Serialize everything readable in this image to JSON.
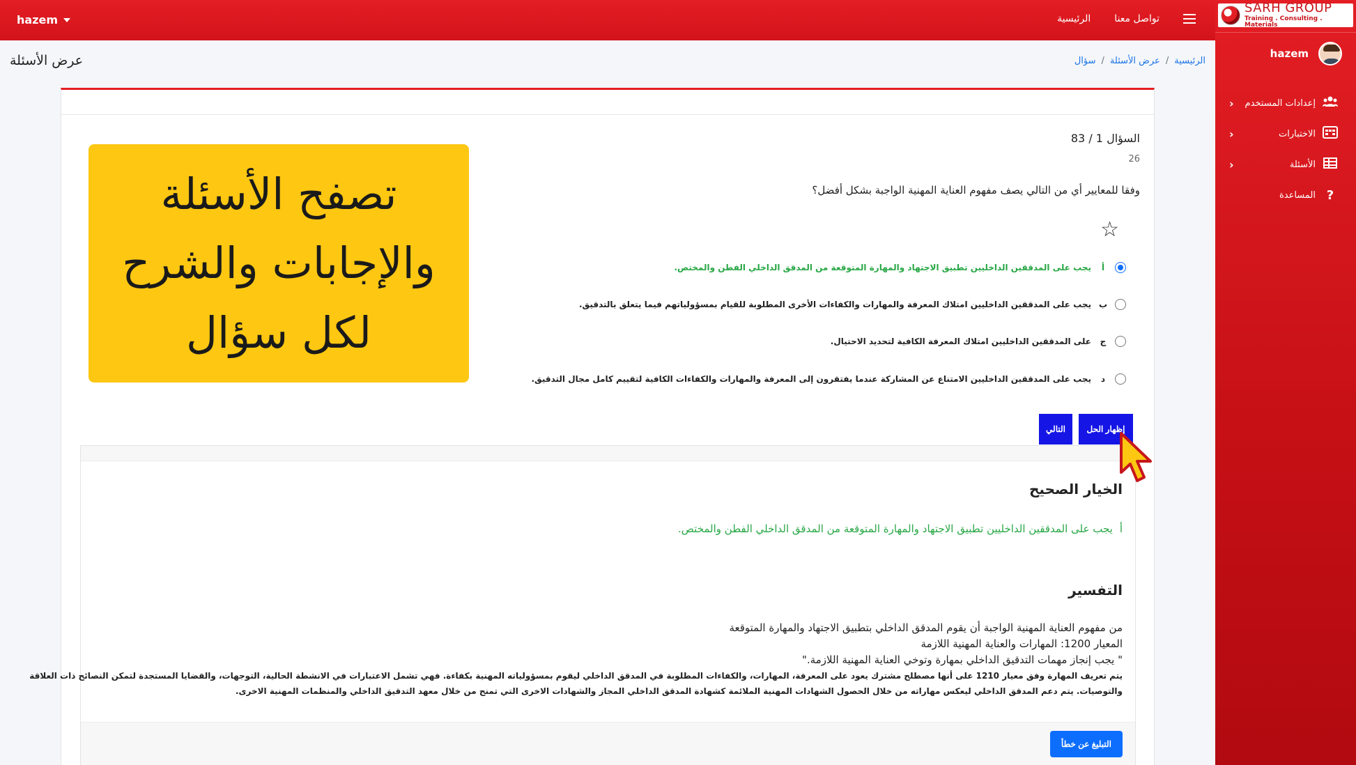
{
  "navbar": {
    "user": "hazem",
    "links": [
      "الرئيسية",
      "تواصل معنا"
    ]
  },
  "sidebar": {
    "logo": {
      "title": "SARH GROUP",
      "subtitle": "Training . Consulting . Materials"
    },
    "user": "hazem",
    "items": [
      {
        "label": "إعدادات المستخدم",
        "icon": "users-icon",
        "has_chevron": true
      },
      {
        "label": "الاختبارات",
        "icon": "tests-icon",
        "has_chevron": true
      },
      {
        "label": "الأسئلة",
        "icon": "table-icon",
        "has_chevron": true
      },
      {
        "label": "المساعدة",
        "icon": "question-icon",
        "has_chevron": false
      }
    ]
  },
  "page": {
    "title": "عرض الأسئلة",
    "breadcrumb": [
      "الرئيسية",
      "عرض الأسئلة",
      "سؤال"
    ]
  },
  "question": {
    "counter": "السؤال 1 / 83",
    "id": "26",
    "text": "وفقا للمعايير أي من التالي يصف مفهوم العناية المهنية الواجبة بشكل أفضل؟",
    "options": [
      {
        "letter": "أ",
        "text": "يجب على المدققين الداخليين تطبيق الاجتهاد والمهارة المتوقعة من المدقق الداخلي الفطن والمختص.",
        "selected": true,
        "correct": true
      },
      {
        "letter": "ب",
        "text": "يجب على المدققين الداخليين امتلاك المعرفة والمهارات والكفاءات الأخرى المطلوبة للقيام بمسؤولياتهم فيما يتعلق بالتدقيق.",
        "selected": false,
        "correct": false
      },
      {
        "letter": "ج",
        "text": "على المدققين الداخليين امتلاك المعرفة الكافية لتحديد الاحتيال.",
        "selected": false,
        "correct": false
      },
      {
        "letter": "د",
        "text": "يجب على المدققين الداخليين الامتناع عن المشاركة عندما يفتقرون إلى المعرفة والمهارات والكفاءات الكافية لتقييم كامل مجال التدقيق.",
        "selected": false,
        "correct": false
      }
    ],
    "show_answer_label": "إظهار الحل",
    "next_label": "التالي"
  },
  "banner": {
    "lines": [
      "تصفح الأسئلة",
      "والإجابات والشرح",
      "لكل سؤال"
    ],
    "color": "#fdc712"
  },
  "answer": {
    "correct_heading": "الخيار الصحيح",
    "correct_letter": "أ",
    "correct_text": "يجب على المدققين الداخليين تطبيق الاجتهاد والمهارة المتوقعة من المدقق الداخلي الفطن والمختص.",
    "explanation_heading": "التفسير",
    "explanation_lines": [
      "من مفهوم العناية المهنية الواجبة أن يقوم المدقق الداخلي بتطبيق الاجتهاد والمهارة المتوقعة",
      "المعيار 1200: المهارات والعناية المهنية اللازمة",
      "\" يجب إنجاز مهمات التدقيق الداخلي بمهارة وتوخي  العناية المهنية اللازمة.\""
    ],
    "explanation_small_lines": [
      "يتم تعريف المهارة وفق معيار 1210 على أنها مصطلح مشترك يعود على المعرفة، المهارات، والكفاءات المطلوبة في المدقق الداخلي ليقوم بمسؤولياته المهنية بكفاءة. فهي تشمل الاعتبارات في الانشطة الحالية، التوجهات، والقضايا المستجدة لتمكن النصائح ذات العلاقة",
      "والتوصيات. يتم دعم المدقق الداخلي ليعكس مهاراته من خلال الحصول الشهادات المهنية الملائمة كشهادة المدقق الداخلي المجاز والشهادات الاخرى التي تمنح من خلال معهد التدقيق الداخلي والمنظمات المهنية الاخرى."
    ],
    "report_label": "التبليغ عن خطأ"
  },
  "colors": {
    "brand_red": "#e31e24",
    "primary_blue": "#1515e6",
    "correct_green": "#28a745"
  }
}
